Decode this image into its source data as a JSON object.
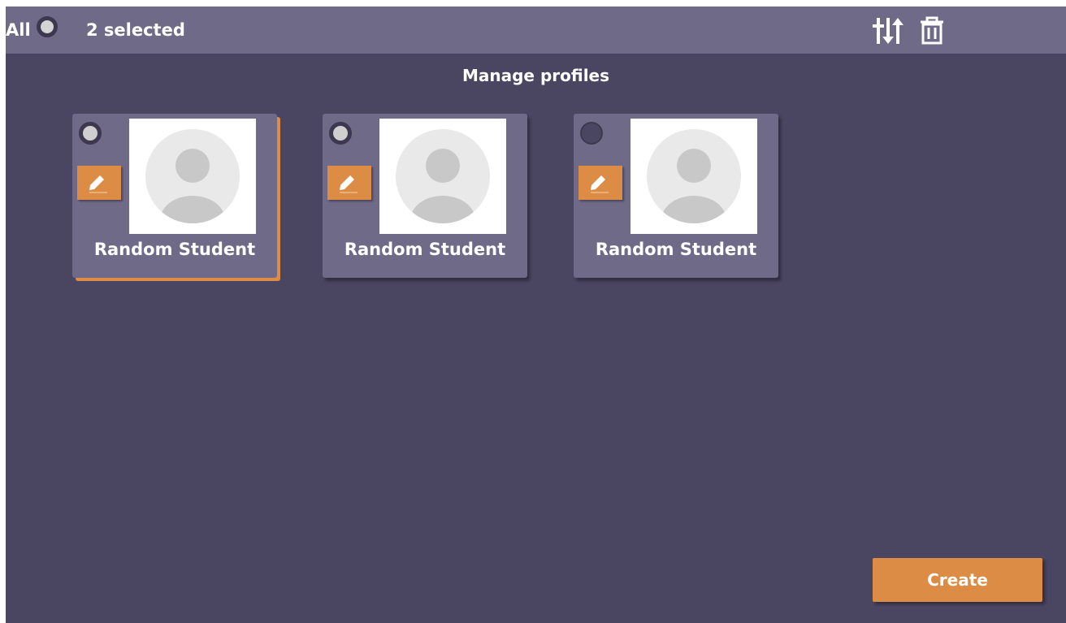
{
  "topbar": {
    "all_label": "All",
    "selected_label": "2 selected",
    "icons": [
      "sort-icon",
      "trash-icon"
    ]
  },
  "title": "Manage profiles",
  "profiles": [
    {
      "name": "Random Student",
      "selected": true,
      "avatar_icon": "default-avatar-icon",
      "edit_icon": "pencil-icon"
    },
    {
      "name": "Random Student",
      "selected": true,
      "avatar_icon": "default-avatar-icon",
      "edit_icon": "pencil-icon"
    },
    {
      "name": "Random Student",
      "selected": false,
      "avatar_icon": "default-avatar-icon",
      "edit_icon": "pencil-icon"
    }
  ],
  "create_label": "Create",
  "colors": {
    "background": "#4a4560",
    "bar": "#6f6a87",
    "accent": "#dc8c45",
    "text": "#ffffff"
  }
}
